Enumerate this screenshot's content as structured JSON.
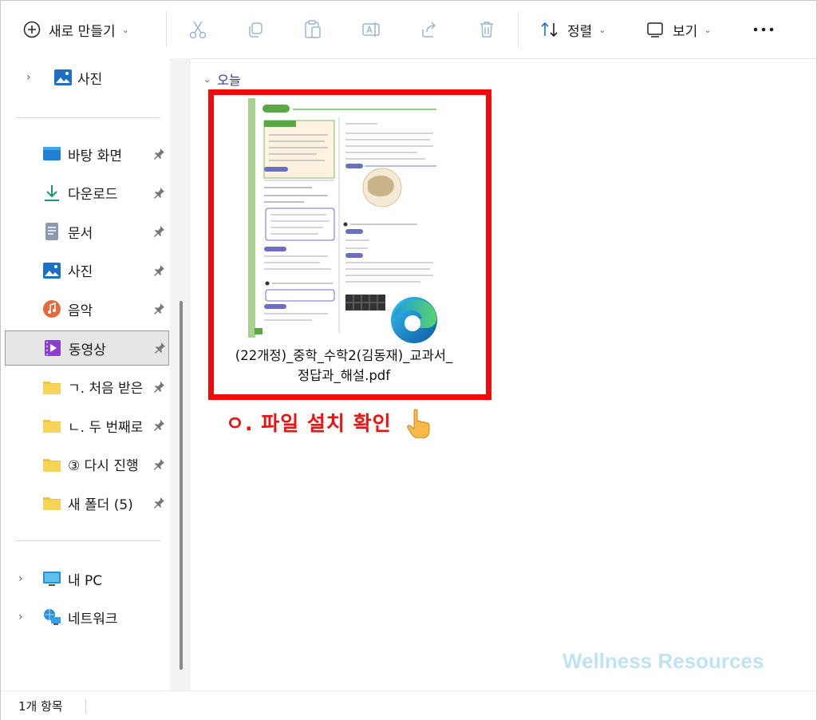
{
  "toolbar": {
    "new_label": "새로 만들기",
    "sort_label": "정렬",
    "view_label": "보기"
  },
  "sidebar": {
    "top_item": "사진",
    "quick": [
      {
        "label": "바탕 화면",
        "icon": "desktop-icon"
      },
      {
        "label": "다운로드",
        "icon": "download-icon"
      },
      {
        "label": "문서",
        "icon": "document-icon"
      },
      {
        "label": "사진",
        "icon": "pictures-icon"
      },
      {
        "label": "음악",
        "icon": "music-icon"
      },
      {
        "label": "동영상",
        "icon": "video-icon"
      },
      {
        "label": "ㄱ. 처음 받은",
        "icon": "folder-icon"
      },
      {
        "label": "ㄴ. 두 번째로",
        "icon": "folder-icon"
      },
      {
        "label": "③ 다시 진행",
        "icon": "folder-icon"
      },
      {
        "label": "새 폴더 (5)",
        "icon": "folder-icon"
      }
    ],
    "this_pc": "내 PC",
    "network": "네트워크"
  },
  "content": {
    "group_label": "오늘",
    "file_name_line1": "(22개정)_중학_수학2(김동재)_교과서_",
    "file_name_line2": "정답과_해설.pdf",
    "annotation": "ㅇ. 파일 설치 확인",
    "watermark": "Wellness Resources"
  },
  "status": {
    "count": "1개 항목"
  },
  "colors": {
    "highlight": "#f00a0a",
    "annotation": "#f01111",
    "watermark": "#bfe3f3",
    "accent": "#1a73c9"
  }
}
